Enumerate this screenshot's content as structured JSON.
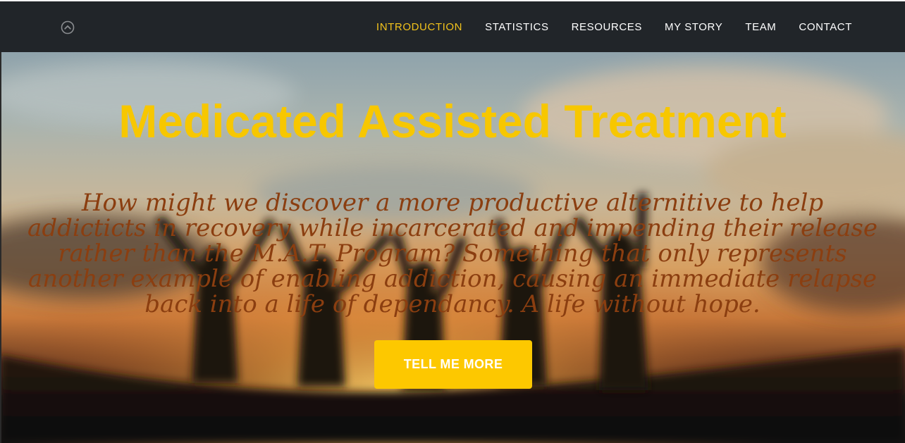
{
  "nav": {
    "logo_icon": "chevron-up-circle-icon",
    "links": [
      {
        "label": "INTRODUCTION",
        "active": true
      },
      {
        "label": "STATISTICS",
        "active": false
      },
      {
        "label": "RESOURCES",
        "active": false
      },
      {
        "label": "MY STORY",
        "active": false
      },
      {
        "label": "TEAM",
        "active": false
      },
      {
        "label": "CONTACT",
        "active": false
      }
    ]
  },
  "hero": {
    "title": "Medicated Assisted Treatment",
    "subtitle_lines": [
      "How might we discover a more productive alternitive to help",
      "addicticts in recovery while incarcerated and impending their release",
      "rather than the M.A.T. Program? Something that only represents",
      "another example of enabling addiction, causing an immediate relapse",
      "back into a life of dependancy. A life without hope."
    ],
    "button_label": "TELL ME MORE"
  },
  "colors": {
    "nav_bg": "#212529",
    "accent": "#fdc800",
    "title": "#f7c700",
    "subtitle": "#8b3e10",
    "active_link": "#f2c21b"
  }
}
